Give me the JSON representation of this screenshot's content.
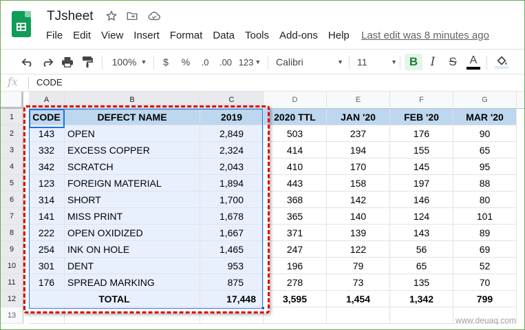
{
  "app": {
    "doc_title": "TJsheet",
    "menu": [
      "File",
      "Edit",
      "View",
      "Insert",
      "Format",
      "Data",
      "Tools",
      "Add-ons",
      "Help"
    ],
    "last_edit": "Last edit was 8 minutes ago",
    "icons": [
      "star-icon",
      "move-to-folder-icon",
      "cloud-saved-icon"
    ]
  },
  "toolbar": {
    "zoom": "100%",
    "currency": "$",
    "percent": "%",
    "decimal_decrease": ".0",
    "decimal_increase": ".00",
    "more_formats": "123",
    "font": "Calibri",
    "font_size": "11",
    "bold": "B",
    "italic": "I",
    "strike": "S",
    "text_color_letter": "A",
    "text_color": "#000000",
    "accent_bold_bg": "#e6f4ea"
  },
  "formula_bar": {
    "fx": "fx",
    "value": "CODE"
  },
  "columns": [
    "A",
    "B",
    "C",
    "D",
    "E",
    "F",
    "G"
  ],
  "rows": [
    "1",
    "2",
    "3",
    "4",
    "5",
    "6",
    "7",
    "8",
    "9",
    "10",
    "11",
    "12",
    "13"
  ],
  "table": {
    "headers": [
      "CODE",
      "DEFECT NAME",
      "2019",
      "2020 TTL",
      "JAN '20",
      "FEB '20",
      "MAR '20"
    ],
    "data": [
      [
        "143",
        "OPEN",
        "2,849",
        "503",
        "237",
        "176",
        "90"
      ],
      [
        "332",
        "EXCESS COPPER",
        "2,324",
        "414",
        "194",
        "155",
        "65"
      ],
      [
        "342",
        "SCRATCH",
        "2,043",
        "410",
        "170",
        "145",
        "95"
      ],
      [
        "123",
        "FOREIGN MATERIAL",
        "1,894",
        "443",
        "158",
        "197",
        "88"
      ],
      [
        "314",
        "SHORT",
        "1,700",
        "368",
        "142",
        "146",
        "80"
      ],
      [
        "141",
        "MISS PRINT",
        "1,678",
        "365",
        "140",
        "124",
        "101"
      ],
      [
        "222",
        "OPEN OXIDIZED",
        "1,667",
        "371",
        "139",
        "143",
        "89"
      ],
      [
        "254",
        "INK ON HOLE",
        "1,465",
        "247",
        "122",
        "56",
        "69"
      ],
      [
        "301",
        "DENT",
        "953",
        "196",
        "79",
        "65",
        "52"
      ],
      [
        "176",
        "SPREAD MARKING",
        "875",
        "278",
        "73",
        "135",
        "70"
      ]
    ],
    "total": [
      "TOTAL",
      "17,448",
      "3,595",
      "1,454",
      "1,342",
      "799"
    ]
  },
  "colors": {
    "header_fill": "#bdd7ee",
    "selection_fill": "#e8f0fe",
    "selection_border": "#1a73e8",
    "highlight_dash": "#e00000",
    "brand_green": "#0f9d58"
  },
  "watermark": "www.deuaq.com"
}
